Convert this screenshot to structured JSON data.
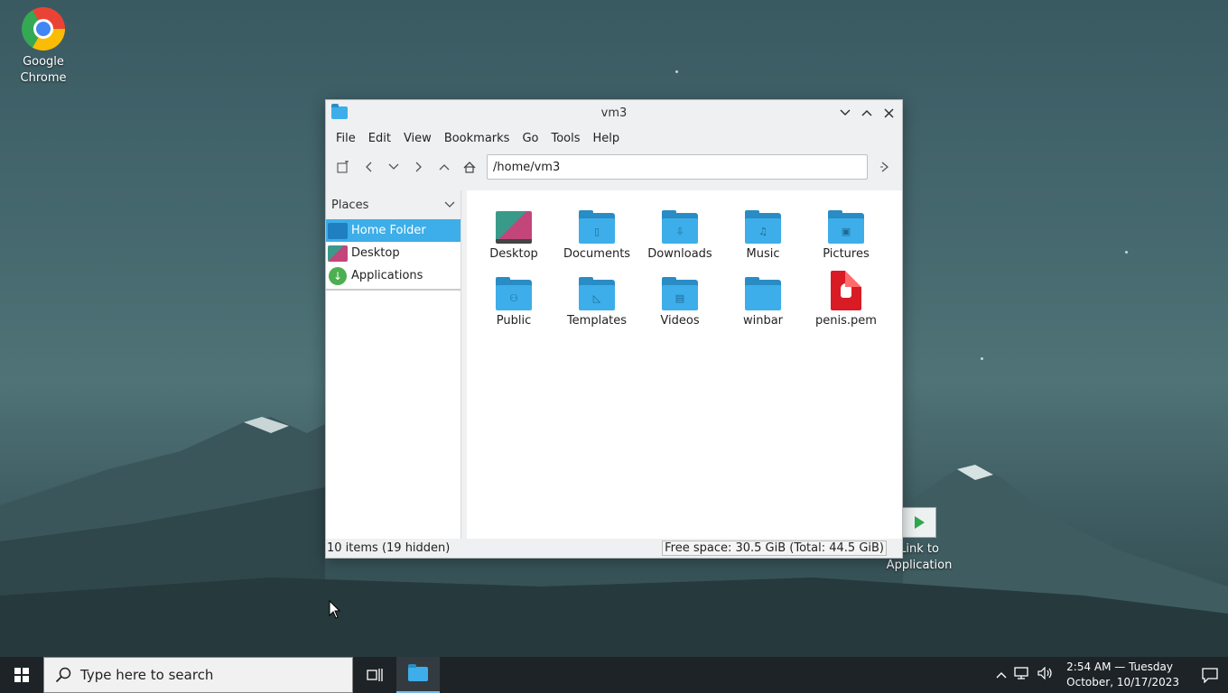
{
  "desktop": {
    "icons": [
      {
        "label": "Google\nChrome",
        "icon": "chrome-icon"
      },
      {
        "label": "Link to\nApplication",
        "icon": "play-icon"
      }
    ]
  },
  "window": {
    "title": "vm3",
    "menu": [
      "File",
      "Edit",
      "View",
      "Bookmarks",
      "Go",
      "Tools",
      "Help"
    ],
    "path": "/home/vm3",
    "places": {
      "header": "Places",
      "items": [
        {
          "label": "Home Folder",
          "icon": "home-folder-icon",
          "active": true
        },
        {
          "label": "Desktop",
          "icon": "desktop-icon",
          "active": false
        },
        {
          "label": "Applications",
          "icon": "applications-icon",
          "active": false
        }
      ]
    },
    "files": [
      {
        "label": "Desktop",
        "kind": "desktop"
      },
      {
        "label": "Documents",
        "kind": "folder",
        "glyph": "▯"
      },
      {
        "label": "Downloads",
        "kind": "folder",
        "glyph": "⇩"
      },
      {
        "label": "Music",
        "kind": "folder",
        "glyph": "♫"
      },
      {
        "label": "Pictures",
        "kind": "folder",
        "glyph": "▣"
      },
      {
        "label": "Public",
        "kind": "folder",
        "glyph": "⚇"
      },
      {
        "label": "Templates",
        "kind": "folder",
        "glyph": "◺"
      },
      {
        "label": "Videos",
        "kind": "folder",
        "glyph": "▤"
      },
      {
        "label": "winbar",
        "kind": "folder",
        "glyph": ""
      },
      {
        "label": "penis.pem",
        "kind": "pem"
      }
    ],
    "status": {
      "items": "10 items (19 hidden)",
      "free": "Free space: 30.5 GiB (Total: 44.5 GiB)"
    }
  },
  "taskbar": {
    "search_placeholder": "Type here to search",
    "clock_line1": "2:54 AM — Tuesday",
    "clock_line2": "October, 10/17/2023"
  },
  "colors": {
    "accent": "#3daee9",
    "taskbar": "#1d2327"
  }
}
